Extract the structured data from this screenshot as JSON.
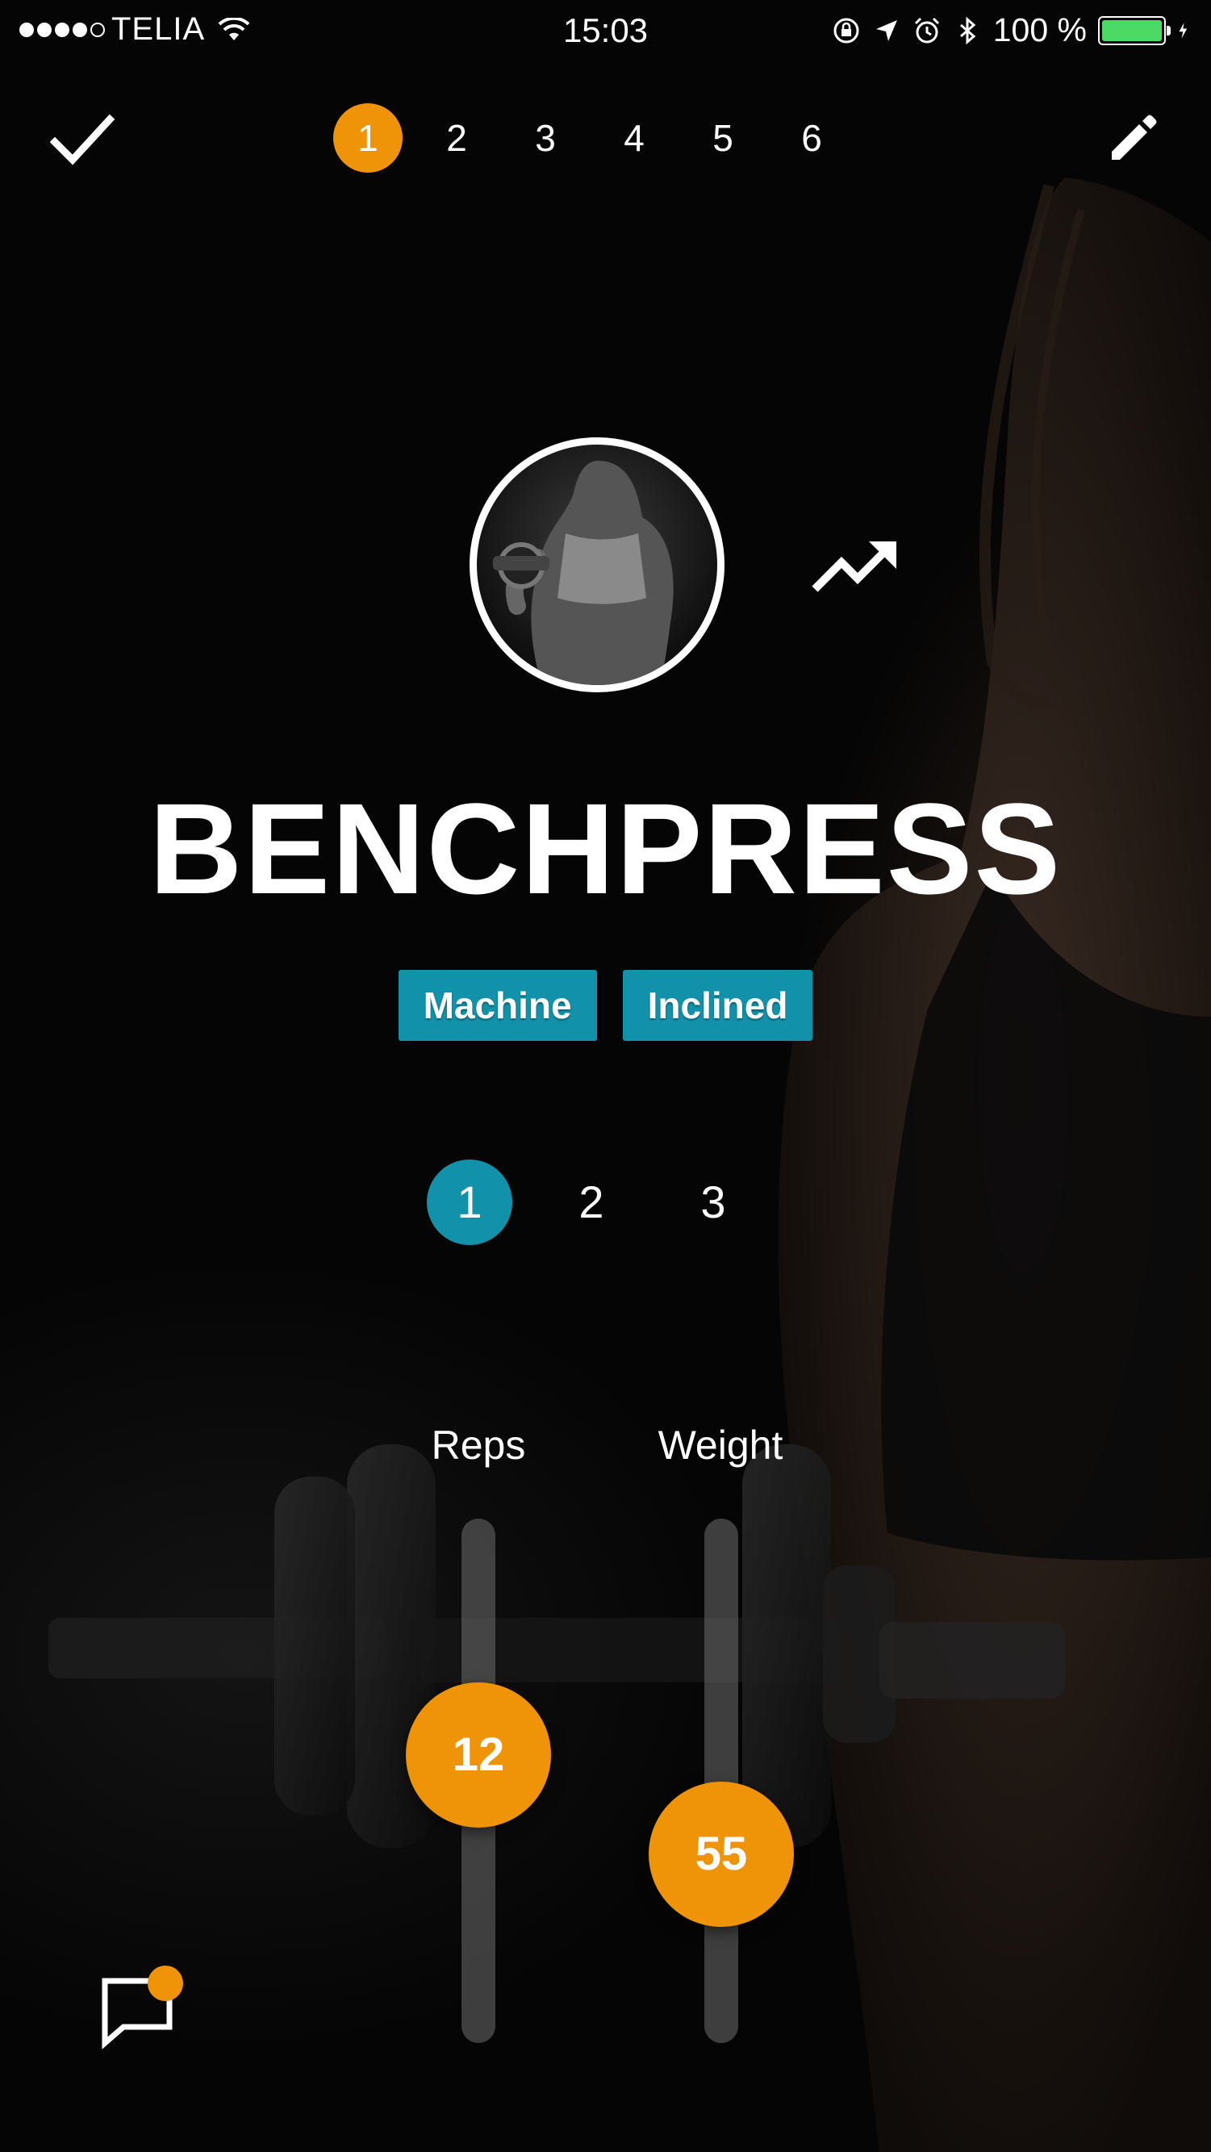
{
  "status_bar": {
    "carrier": "TELIA",
    "time": "15:03",
    "battery": "100 %",
    "battery_level": 1.0,
    "signal_bars": 4,
    "battery_color": "#4cd964"
  },
  "top_nav": {
    "done_icon": "checkmark-icon",
    "edit_icon": "pencil-icon",
    "exercise_steps": [
      "1",
      "2",
      "3",
      "4",
      "5",
      "6"
    ],
    "active_step": "1"
  },
  "exercise": {
    "name": "BENCHPRESS",
    "tags": [
      "Machine",
      "Inclined"
    ],
    "stats_icon": "trending-up-icon",
    "avatar": "exercise-photo"
  },
  "sets": {
    "items": [
      "1",
      "2",
      "3"
    ],
    "active": "1"
  },
  "sliders": {
    "reps": {
      "label": "Reps",
      "value": "12",
      "level": 0.55
    },
    "weight": {
      "label": "Weight",
      "value": "55",
      "level": 0.36
    }
  },
  "comments": {
    "icon": "comment-icon",
    "has_unread": true
  },
  "colors": {
    "accent_orange": "#ef9308",
    "accent_teal": "#1292aa",
    "background": "#050505"
  }
}
